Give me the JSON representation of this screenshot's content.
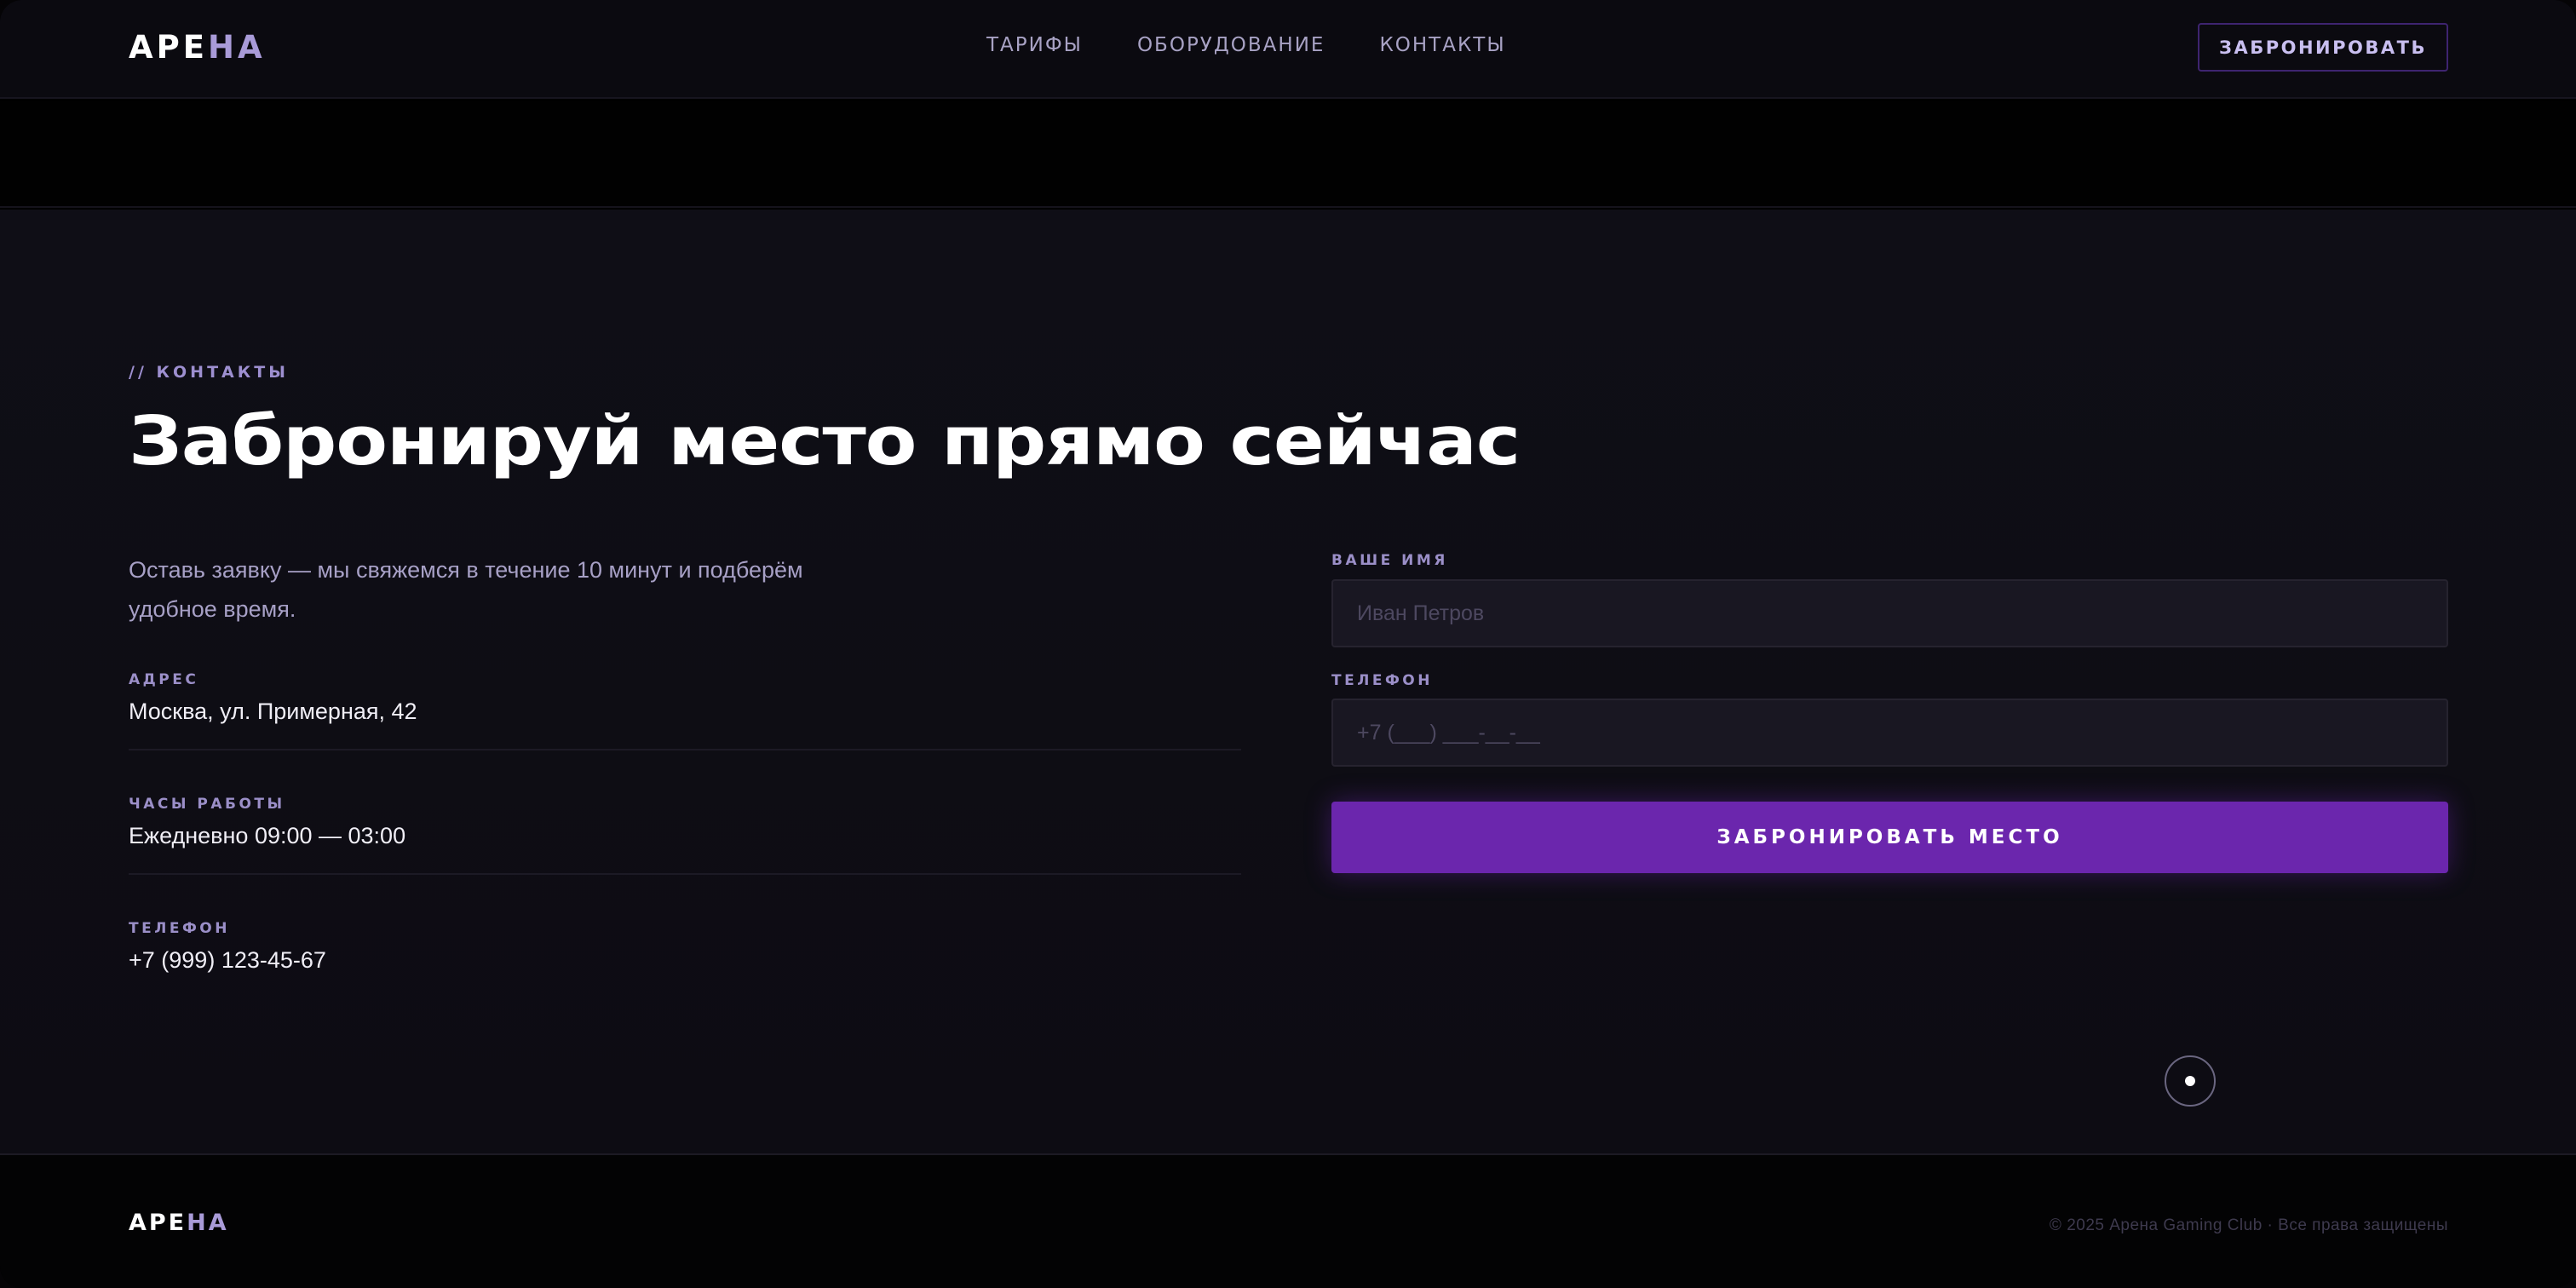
{
  "header": {
    "logo_main": "АРЕ",
    "logo_accent": "НА",
    "nav": [
      "ТАРИФЫ",
      "ОБОРУДОВАНИЕ",
      "КОНТАКТЫ"
    ],
    "cta_label": "ЗАБРОНИРОВАТЬ"
  },
  "contacts": {
    "eyebrow": "// КОНТАКТЫ",
    "title": "Забронируй место прямо сейчас",
    "lead": "Оставь заявку — мы свяжемся в течение 10 минут и подберём удобное время.",
    "info": [
      {
        "label": "АДРЕС",
        "value": "Москва, ул. Примерная, 42"
      },
      {
        "label": "ЧАСЫ РАБОТЫ",
        "value": "Ежедневно 09:00 — 03:00"
      },
      {
        "label": "ТЕЛЕФОН",
        "value": "+7 (999) 123-45-67"
      }
    ]
  },
  "form": {
    "name_label": "ВАШЕ ИМЯ",
    "name_placeholder": "Иван Петров",
    "phone_label": "ТЕЛЕФОН",
    "phone_placeholder": "+7 (___) ___-__-__",
    "submit_label": "ЗАБРОНИРОВАТЬ МЕСТО"
  },
  "footer": {
    "logo_main": "АРЕ",
    "logo_accent": "НА",
    "copyright": "© 2025 Арена Gaming Club · Все права защищены"
  },
  "colors": {
    "accent": "#6b26ad",
    "logo_accent": "#a99bd8",
    "background": "#0f0e16"
  },
  "icons": {
    "floating_button": "dot-icon"
  }
}
